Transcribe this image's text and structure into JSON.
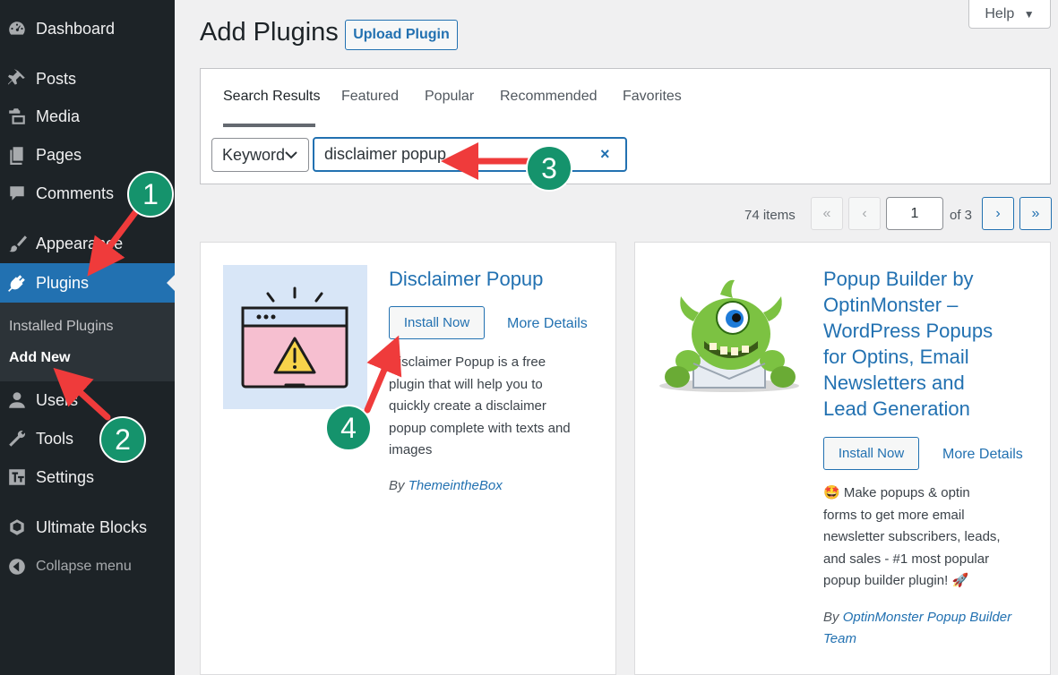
{
  "sidebar": {
    "items": [
      {
        "label": "Dashboard",
        "icon": "dashboard-icon"
      },
      {
        "label": "Posts",
        "icon": "pin-icon"
      },
      {
        "label": "Media",
        "icon": "media-icon"
      },
      {
        "label": "Pages",
        "icon": "pages-icon"
      },
      {
        "label": "Comments",
        "icon": "comment-icon"
      },
      {
        "label": "Appearance",
        "icon": "brush-icon"
      },
      {
        "label": "Plugins",
        "icon": "plugin-icon"
      },
      {
        "label": "Users",
        "icon": "users-icon"
      },
      {
        "label": "Tools",
        "icon": "wrench-icon"
      },
      {
        "label": "Settings",
        "icon": "settings-icon"
      },
      {
        "label": "Ultimate Blocks",
        "icon": "blocks-icon"
      }
    ],
    "submenu": [
      "Installed Plugins",
      "Add New"
    ],
    "collapse_label": "Collapse menu"
  },
  "header": {
    "title": "Add Plugins",
    "upload_label": "Upload Plugin",
    "help_label": "Help"
  },
  "filter": {
    "tabs": [
      "Search Results",
      "Featured",
      "Popular",
      "Recommended",
      "Favorites"
    ],
    "keyword_label": "Keyword",
    "search_value": "disclaimer popup",
    "clear_glyph": "×"
  },
  "pagination": {
    "items": "74 items",
    "first": "«",
    "prev": "‹",
    "current": "1",
    "of": "of 3",
    "next": "›",
    "last": "»"
  },
  "cards": [
    {
      "title": "Disclaimer Popup",
      "install_label": "Install Now",
      "more_label": "More Details",
      "desc_lines": [
        "Disclaimer Popup is a free",
        "plugin that will help you to",
        "quickly create a disclaimer",
        "popup complete with texts and",
        "images"
      ],
      "author_prefix": "By ",
      "author": "ThemeintheBox"
    },
    {
      "title_lines": [
        "Popup Builder by",
        "OptinMonster –",
        "WordPress Popups",
        "for Optins, Email",
        "Newsletters and",
        "Lead Generation"
      ],
      "install_label": "Install Now",
      "more_label": "More Details",
      "desc_lines": [
        "🤩 Make popups & optin",
        "forms to get more email",
        "newsletter subscribers, leads,",
        "and sales - #1 most popular",
        "popup builder plugin! 🚀"
      ],
      "author_prefix": "By ",
      "author_lines": [
        "OptinMonster Popup Builder",
        "Team"
      ]
    }
  ],
  "annotations": [
    "1",
    "2",
    "3",
    "4"
  ],
  "colors": {
    "accent": "#2271b1",
    "sidebar": "#1d2327",
    "badge": "#15936c",
    "arrow": "#ef3b3b"
  }
}
